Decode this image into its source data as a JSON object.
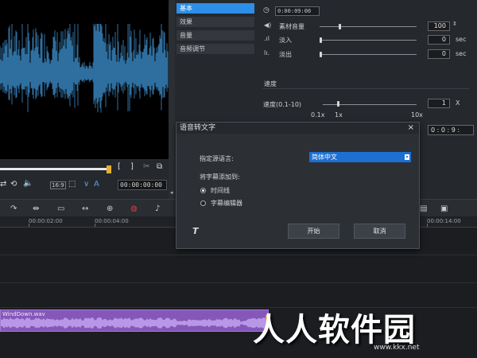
{
  "preview": {
    "timecode": "00:00:00:00",
    "ctl_bracket_in": "[",
    "ctl_bracket_out": "]",
    "zoom_label": "16:9",
    "letter_a": "A"
  },
  "props": {
    "tabs": [
      "基本",
      "效果",
      "音量",
      "音频调节"
    ],
    "duration": "0:00:09:00",
    "volume_label": "素材音量",
    "volume_value": "100",
    "fade_in_label": "淡入",
    "fade_in_value": "0",
    "fade_out_label": "淡出",
    "fade_out_value": "0",
    "unit_sec": "sec",
    "speed_section": "速度",
    "speed_label": "速度(0.1-10)",
    "speed_value": "1",
    "speed_unit": "X",
    "scale_min": "0.1x",
    "scale_mid": "1x",
    "scale_max": "10x",
    "time_stretch": "0 : 0 : 9 :"
  },
  "dialog": {
    "title": "语音转文字",
    "close": "×",
    "lang_label": "指定源语言:",
    "lang_value": "简体中文",
    "add_to_label": "将字幕添加到:",
    "option_timeline": "时间线",
    "option_editor": "字幕编辑器",
    "start_button": "开始",
    "cancel_button": "取消",
    "icon_text": "T"
  },
  "timeline": {
    "ticks": [
      "00:00:02:00",
      "00:00:04:00",
      "00:00:14:00"
    ],
    "clip_name": "WindDown.wav"
  },
  "watermark": {
    "text": "人人软件园",
    "sub": "www.kkx.net"
  },
  "colors": {
    "accent": "#2d8ee8",
    "clip": "#8457b8",
    "waveform": "#2f6fa0"
  }
}
